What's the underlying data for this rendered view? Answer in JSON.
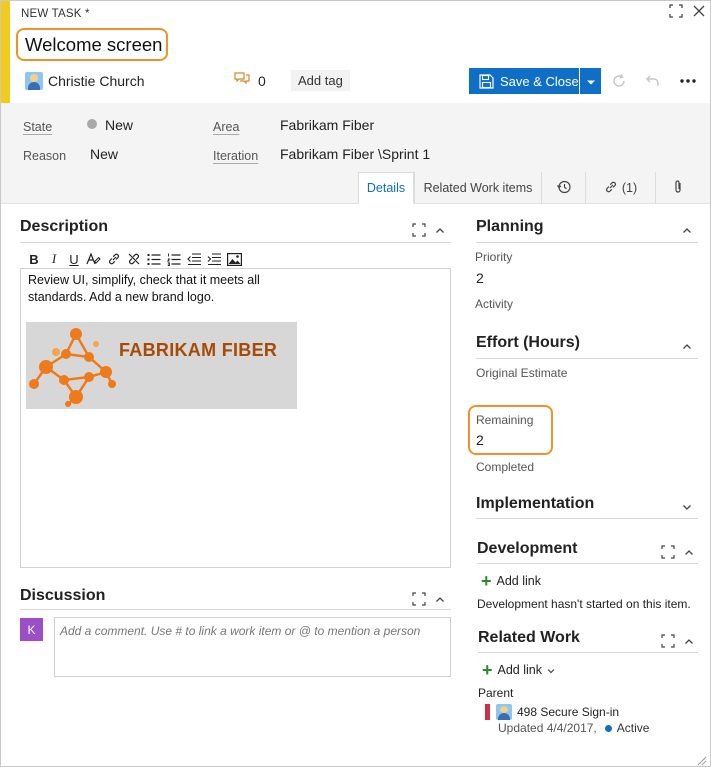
{
  "header": {
    "work_item_type": "NEW TASK *",
    "title": "Welcome screen",
    "assignee": "Christie Church",
    "comment_count": "0",
    "add_tag": "Add tag",
    "save_label": "Save & Close"
  },
  "fields": {
    "state_label": "State",
    "state_value": "New",
    "reason_label": "Reason",
    "reason_value": "New",
    "area_label": "Area",
    "area_value": "Fabrikam Fiber",
    "iteration_label": "Iteration",
    "iteration_value": "Fabrikam Fiber \\Sprint 1"
  },
  "tabs": {
    "details": "Details",
    "related": "Related Work items",
    "links": "(1)"
  },
  "description": {
    "title": "Description",
    "text": "Review UI, simplify, check that it meets all standards. Add a new brand logo.",
    "logo_text": "FABRIKAM FIBER"
  },
  "discussion": {
    "title": "Discussion",
    "avatar_letter": "K",
    "placeholder": "Add a comment. Use # to link a work item or @ to mention a person"
  },
  "planning": {
    "title": "Planning",
    "priority_label": "Priority",
    "priority_value": "2",
    "activity_label": "Activity"
  },
  "effort": {
    "title": "Effort (Hours)",
    "original_label": "Original Estimate",
    "remaining_label": "Remaining",
    "remaining_value": "2",
    "completed_label": "Completed"
  },
  "implementation": {
    "title": "Implementation"
  },
  "development": {
    "title": "Development",
    "add_link": "Add link",
    "message": "Development hasn't started on this item."
  },
  "related_work": {
    "title": "Related Work",
    "add_link": "Add link",
    "parent_label": "Parent",
    "parent_item": "498 Secure Sign-in",
    "parent_updated": "Updated 4/4/2017,",
    "parent_state": "Active"
  },
  "colors": {
    "accent_bar": "#f2cb1d",
    "highlight": "#f0922b",
    "primary": "#0f6fc6",
    "logo_text": "#a54a08"
  }
}
